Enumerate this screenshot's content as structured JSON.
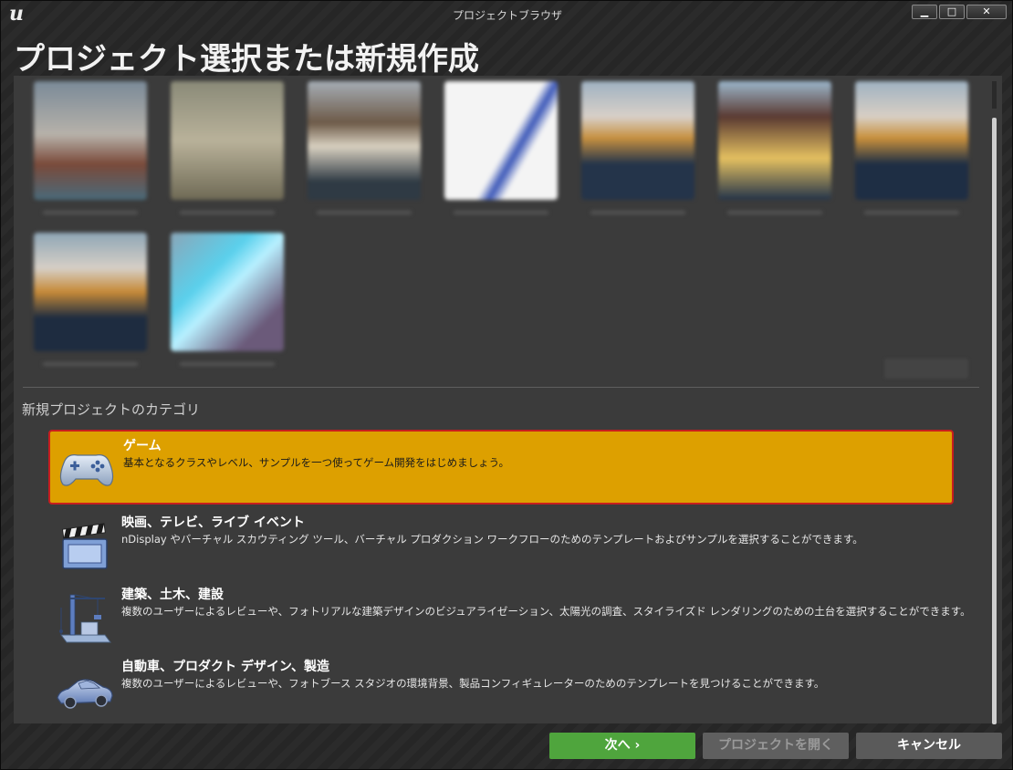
{
  "window": {
    "title": "プロジェクトブラウザ",
    "controls": {
      "minimize": "▁",
      "maximize": "□",
      "close": "✕"
    }
  },
  "page": {
    "title": "プロジェクト選択または新規作成"
  },
  "new_project": {
    "section_label": "新規プロジェクトのカテゴリ",
    "categories": [
      {
        "title": "ゲーム",
        "description": "基本となるクラスやレベル、サンプルを一つ使ってゲーム開発をはじめましょう。",
        "icon": "gamepad-icon",
        "selected": true
      },
      {
        "title": "映画、テレビ、ライブ イベント",
        "description": "nDisplay やバーチャル スカウティング ツール、バーチャル プロダクション ワークフローのためのテンプレートおよびサンプルを選択することができます。",
        "icon": "clapperboard-icon",
        "selected": false
      },
      {
        "title": "建築、土木、建設",
        "description": "複数のユーザーによるレビューや、フォトリアルな建築デザインのビジュアライゼーション、太陽光の調査、スタイライズド レンダリングのための土台を選択することができます。",
        "icon": "crane-icon",
        "selected": false
      },
      {
        "title": "自動車、プロダクト デザイン、製造",
        "description": "複数のユーザーによるレビューや、フォトブース スタジオの環境背景、製品コンフィギュレーターのためのテンプレートを見つけることができます。",
        "icon": "car-icon",
        "selected": false
      }
    ]
  },
  "footer": {
    "next_label": "次へ ›",
    "open_label": "プロジェクトを開く",
    "cancel_label": "キャンセル"
  },
  "colors": {
    "selected_bg": "#dda000",
    "selected_border": "#c81e1e",
    "next_button": "#4fa53d"
  }
}
